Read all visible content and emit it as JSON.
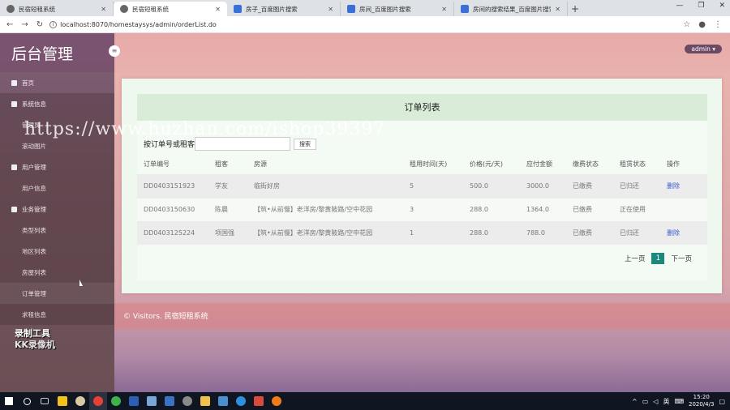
{
  "browser": {
    "tabs": [
      {
        "title": "民宿短租系统",
        "active": false
      },
      {
        "title": "民宿短租系统",
        "active": true
      },
      {
        "title": "房子_百度图片搜索",
        "active": false
      },
      {
        "title": "房间_百度图片搜索",
        "active": false
      },
      {
        "title": "房间的搜索结果_百度图片搜索",
        "active": false
      }
    ],
    "new_tab": "+",
    "url": "localhost:8070/homestaysys/admin/orderList.do"
  },
  "sidebar": {
    "brand": "后台管理",
    "items": [
      {
        "label": "首页",
        "type": "top"
      },
      {
        "label": "系统信息",
        "type": "group"
      },
      {
        "label": "管理员",
        "type": "sub"
      },
      {
        "label": "滚动图片",
        "type": "sub"
      },
      {
        "label": "用户管理",
        "type": "group"
      },
      {
        "label": "用户信息",
        "type": "sub"
      },
      {
        "label": "业务管理",
        "type": "group"
      },
      {
        "label": "类型列表",
        "type": "sub"
      },
      {
        "label": "地区列表",
        "type": "sub"
      },
      {
        "label": "房屋列表",
        "type": "sub"
      },
      {
        "label": "订单管理",
        "type": "sub",
        "active": true
      },
      {
        "label": "求租信息",
        "type": "sub"
      }
    ]
  },
  "header": {
    "user": "admin"
  },
  "card": {
    "title": "订单列表",
    "search_label": "按订单号或租客",
    "search_value": "",
    "search_button": "搜索"
  },
  "table": {
    "columns": [
      "订单编号",
      "租客",
      "房源",
      "租用时间(天)",
      "价格(元/天)",
      "应付金额",
      "缴费状态",
      "租赁状态",
      "操作"
    ],
    "rows": [
      [
        "DD0403151923",
        "学友",
        "临街好房",
        "5",
        "500.0",
        "3000.0",
        "已缴费",
        "已归还",
        "删除"
      ],
      [
        "DD0403150630",
        "陈晨",
        "【筑•从前慢】老洋房/黎黄陂路/空中花园",
        "3",
        "288.0",
        "1364.0",
        "已缴费",
        "正在使用",
        ""
      ],
      [
        "DD0403125224",
        "项国强",
        "【筑•从前慢】老洋房/黎黄陂路/空中花园",
        "1",
        "288.0",
        "788.0",
        "已缴费",
        "已归还",
        "删除"
      ]
    ]
  },
  "pager": {
    "prev": "上一页",
    "current": "1",
    "next": "下一页"
  },
  "footer": "© Visitors. 民宿短租系统",
  "overlay": {
    "watermark": "https://www.huzhan.com/ishop39397",
    "recorder_line1": "录制工具",
    "recorder_line2": "KK录像机"
  },
  "taskbar": {
    "ime": "英",
    "time": "15:20",
    "date": "2020/4/3"
  }
}
